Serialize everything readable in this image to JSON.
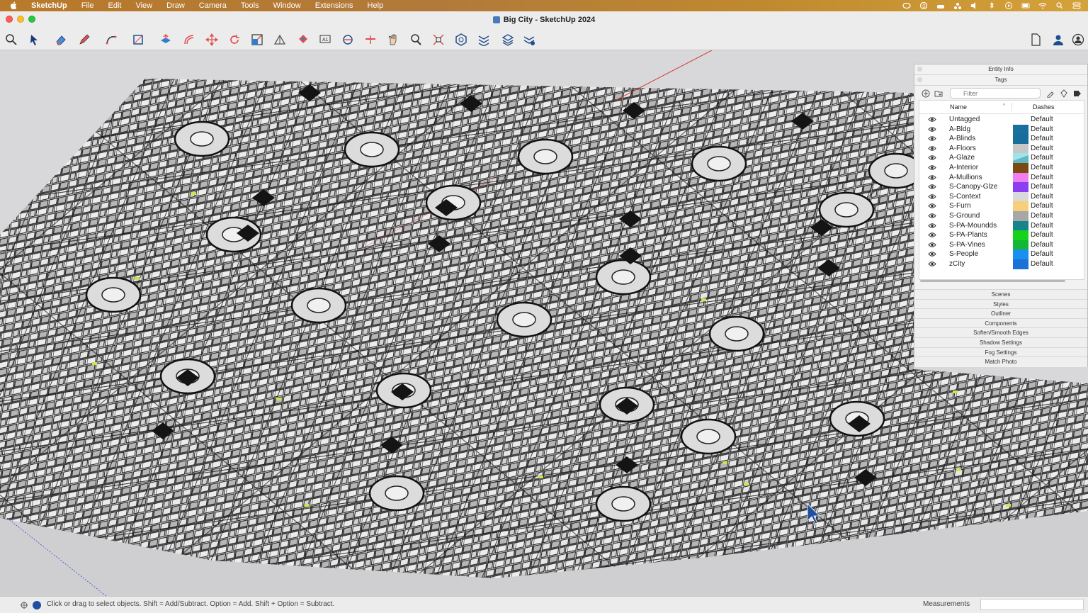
{
  "menubar": {
    "app_name": "SketchUp",
    "items": [
      "File",
      "Edit",
      "View",
      "Draw",
      "Camera",
      "Tools",
      "Window",
      "Extensions",
      "Help"
    ],
    "status_icons": [
      "creative-cloud-icon",
      "sketchup-status-icon",
      "cloud-icon",
      "cluster-icon",
      "volume-icon",
      "bluetooth-icon",
      "play-icon",
      "battery-icon",
      "wifi-icon",
      "spotlight-icon",
      "control-center-icon"
    ]
  },
  "window": {
    "title": "Big City - SketchUp 2024"
  },
  "toolbar": {
    "tools": [
      "search-icon",
      "select-icon",
      "eraser-icon",
      "pencil-icon",
      "arc-icon",
      "rectangle-icon",
      "push-pull-icon",
      "offset-icon",
      "move-icon",
      "rotate-icon",
      "scale-icon",
      "tape-measure-icon",
      "paint-bucket-icon",
      "text-icon",
      "orbit-icon",
      "section-plane-icon",
      "pan-icon",
      "zoom-icon",
      "zoom-extents-icon",
      "warehouse-icon",
      "extension-icon",
      "layers-icon",
      "sandbox-icon"
    ],
    "right_tools": [
      "new-document-icon",
      "account-icon",
      "profile-icon"
    ]
  },
  "tray": {
    "entity_info_label": "Entity Info",
    "tags_label": "Tags",
    "filter_placeholder": "Filter",
    "columns": {
      "name": "Name",
      "dashes": "Dashes"
    },
    "tags": [
      {
        "name": "Untagged",
        "color": "#ffffff",
        "dashes": "Default"
      },
      {
        "name": "A-Bldg",
        "color": "#1b6f9c",
        "dashes": "Default"
      },
      {
        "name": "A-Blinds",
        "color": "#186d9a",
        "dashes": "Default"
      },
      {
        "name": "A-Floors",
        "color": "#c7c7c7",
        "dashes": "Default"
      },
      {
        "name": "A-Glaze",
        "color": "#9fe4ea",
        "dashes": "Default"
      },
      {
        "name": "A-Interior",
        "color": "#7a4a12",
        "dashes": "Default"
      },
      {
        "name": "A-Mullions",
        "color": "#f07ef0",
        "dashes": "Default"
      },
      {
        "name": "S-Canopy-Glze",
        "color": "#8b3df2",
        "dashes": "Default"
      },
      {
        "name": "S-Context",
        "color": "#d9d9d9",
        "dashes": "Default"
      },
      {
        "name": "S-Furn",
        "color": "#f5cf7a",
        "dashes": "Default"
      },
      {
        "name": "S-Ground",
        "color": "#a7a7a7",
        "dashes": "Default"
      },
      {
        "name": "S-PA-Moundds",
        "color": "#16848a",
        "dashes": "Default"
      },
      {
        "name": "S-PA-Plants",
        "color": "#16d21c",
        "dashes": "Default"
      },
      {
        "name": "S-PA-Vines",
        "color": "#10b836",
        "dashes": "Default"
      },
      {
        "name": "S-People",
        "color": "#1a8ff0",
        "dashes": "Default"
      },
      {
        "name": "zCity",
        "color": "#1a72d6",
        "dashes": "Default"
      }
    ],
    "collapsed_panels": [
      "Scenes",
      "Styles",
      "Outliner",
      "Components",
      "Soften/Smooth Edges",
      "Shadow Settings",
      "Fog Settings",
      "Match Photo"
    ]
  },
  "statusbar": {
    "hint": "Click or drag to select objects. Shift = Add/Subtract. Option = Add. Shift + Option = Subtract.",
    "measurements_label": "Measurements"
  }
}
